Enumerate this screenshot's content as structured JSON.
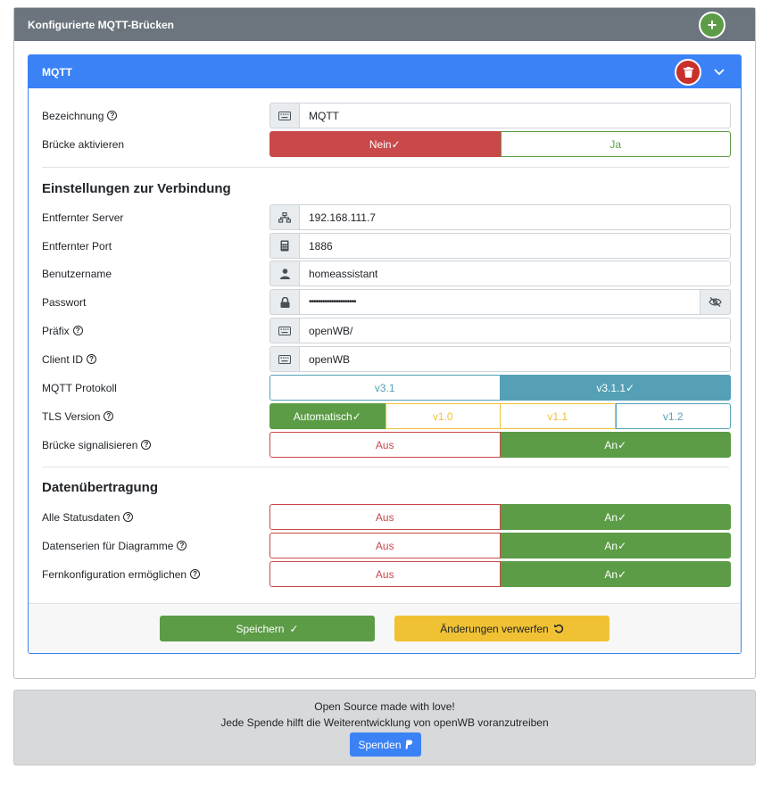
{
  "outer": {
    "title": "Konfigurierte MQTT-Brücken",
    "add_symbol": "+"
  },
  "bridge": {
    "title": "MQTT",
    "fields": {
      "bezeichnung": {
        "label": "Bezeichnung",
        "value": "MQTT"
      },
      "aktivieren": {
        "label": "Brücke aktivieren",
        "options": [
          "Nein",
          "Ja"
        ],
        "selected": "Nein"
      }
    },
    "connection": {
      "heading": "Einstellungen zur Verbindung",
      "server": {
        "label": "Entfernter Server",
        "value": "192.168.111.7"
      },
      "port": {
        "label": "Entfernter Port",
        "value": "1886"
      },
      "user": {
        "label": "Benutzername",
        "value": "homeassistant"
      },
      "password": {
        "label": "Passwort",
        "value": "•••••••••••••••••••••"
      },
      "prefix": {
        "label": "Präfix",
        "value": "openWB/"
      },
      "client_id": {
        "label": "Client ID",
        "value": "openWB"
      },
      "protocol": {
        "label": "MQTT Protokoll",
        "options": [
          "v3.1",
          "v3.1.1"
        ],
        "selected": "v3.1.1"
      },
      "tls": {
        "label": "TLS Version",
        "options": [
          "Automatisch",
          "v1.0",
          "v1.1",
          "v1.2"
        ],
        "selected": "Automatisch"
      },
      "signal": {
        "label": "Brücke signalisieren",
        "options": [
          "Aus",
          "An"
        ],
        "selected": "An"
      }
    },
    "transfer": {
      "heading": "Datenübertragung",
      "status": {
        "label": "Alle Statusdaten",
        "options": [
          "Aus",
          "An"
        ],
        "selected": "An"
      },
      "series": {
        "label": "Datenserien für Diagramme",
        "options": [
          "Aus",
          "An"
        ],
        "selected": "An"
      },
      "remote": {
        "label": "Fernkonfiguration ermöglichen",
        "options": [
          "Aus",
          "An"
        ],
        "selected": "An"
      }
    },
    "actions": {
      "save": "Speichern",
      "discard": "Änderungen verwerfen"
    }
  },
  "footer": {
    "line1": "Open Source made with love!",
    "line2": "Jede Spende hilft die Weiterentwicklung von openWB voranzutreiben",
    "donate": "Spenden"
  },
  "colors": {
    "green": "#5c9c47",
    "red": "#c9484a",
    "teal": "#55a0b6",
    "yellow": "#f0c233",
    "blue": "#3b82f6",
    "gray": "#6c757d"
  }
}
